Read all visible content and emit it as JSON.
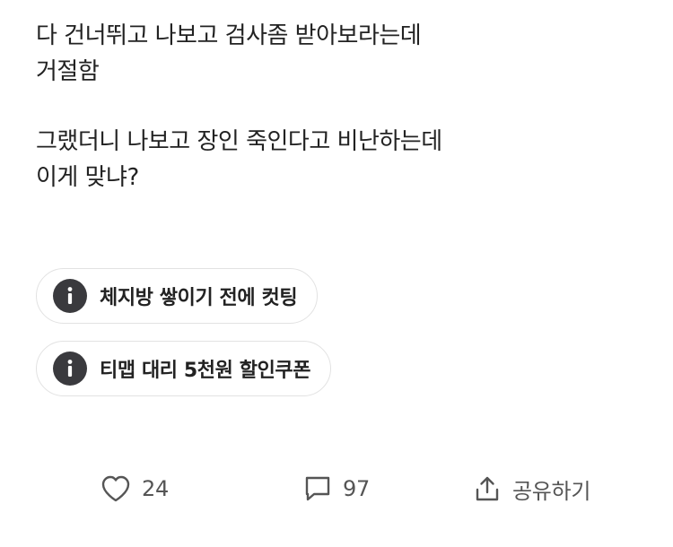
{
  "post": {
    "paragraphs": [
      {
        "lines": [
          "다 건너뛰고 나보고 검사좀 받아보라는데",
          "거절함"
        ]
      },
      {
        "lines": [
          "그랬더니 나보고 장인 죽인다고 비난하는데",
          "이게 맞냐?"
        ]
      }
    ]
  },
  "related_links": [
    {
      "icon": "info-icon",
      "label": "체지방 쌓이기 전에 컷팅"
    },
    {
      "icon": "info-icon",
      "label": "티맵 대리 5천원 할인쿠폰"
    }
  ],
  "actions": {
    "like": {
      "icon": "heart-icon",
      "count": "24"
    },
    "comment": {
      "icon": "comment-icon",
      "count": "97"
    },
    "share": {
      "icon": "share-icon",
      "label": "공유하기"
    }
  },
  "colors": {
    "text": "#222222",
    "muted": "#555555",
    "chip_border": "#e2e2e2",
    "info_icon_bg": "#3a3a3e"
  }
}
